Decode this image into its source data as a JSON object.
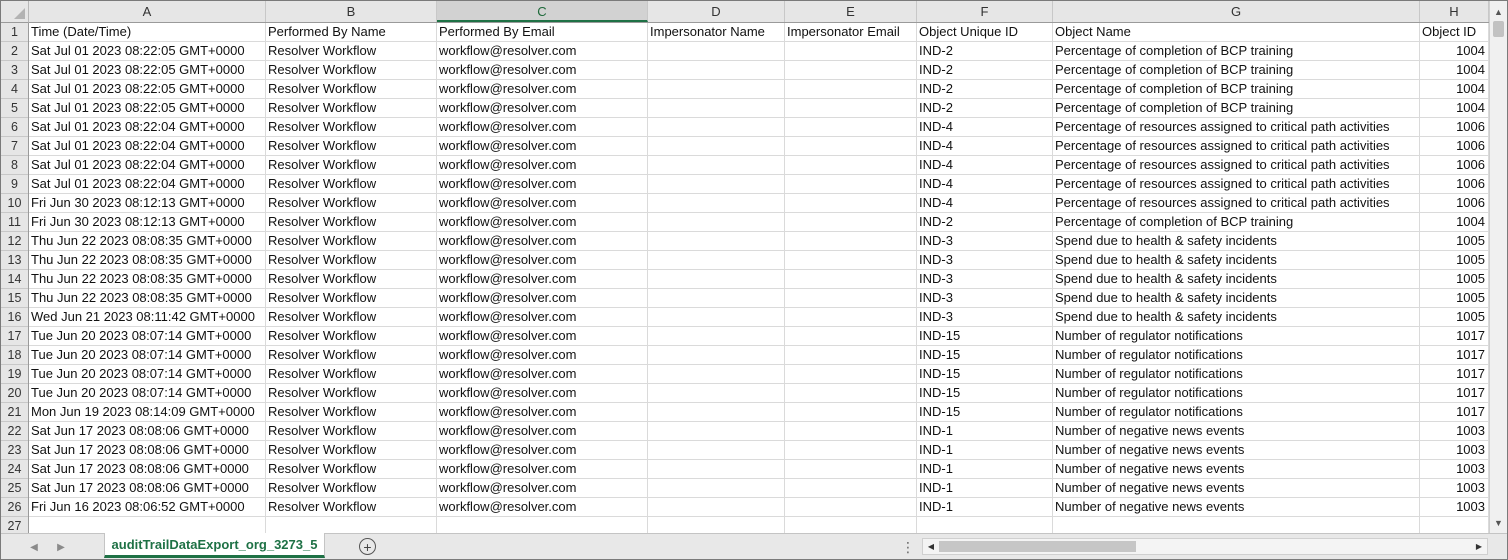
{
  "columns": [
    "A",
    "B",
    "C",
    "D",
    "E",
    "F",
    "G",
    "H"
  ],
  "active_column": "C",
  "row_numbers": [
    "1",
    "2",
    "3",
    "4",
    "5",
    "6",
    "7",
    "8",
    "9",
    "10",
    "11",
    "12",
    "13",
    "14",
    "15",
    "16",
    "17",
    "18",
    "19",
    "20",
    "21",
    "22",
    "23",
    "24",
    "25",
    "26",
    "27"
  ],
  "rows": [
    [
      "Time (Date/Time)",
      "Performed By Name",
      "Performed By Email",
      "Impersonator Name",
      "Impersonator Email",
      "Object Unique ID",
      "Object Name",
      "Object ID"
    ],
    [
      "Sat Jul 01 2023 08:22:05 GMT+0000",
      "Resolver Workflow",
      "workflow@resolver.com",
      "",
      "",
      "IND-2",
      "Percentage of completion of BCP training",
      "1004"
    ],
    [
      "Sat Jul 01 2023 08:22:05 GMT+0000",
      "Resolver Workflow",
      "workflow@resolver.com",
      "",
      "",
      "IND-2",
      "Percentage of completion of BCP training",
      "1004"
    ],
    [
      "Sat Jul 01 2023 08:22:05 GMT+0000",
      "Resolver Workflow",
      "workflow@resolver.com",
      "",
      "",
      "IND-2",
      "Percentage of completion of BCP training",
      "1004"
    ],
    [
      "Sat Jul 01 2023 08:22:05 GMT+0000",
      "Resolver Workflow",
      "workflow@resolver.com",
      "",
      "",
      "IND-2",
      "Percentage of completion of BCP training",
      "1004"
    ],
    [
      "Sat Jul 01 2023 08:22:04 GMT+0000",
      "Resolver Workflow",
      "workflow@resolver.com",
      "",
      "",
      "IND-4",
      "Percentage of resources assigned to critical path activities",
      "1006"
    ],
    [
      "Sat Jul 01 2023 08:22:04 GMT+0000",
      "Resolver Workflow",
      "workflow@resolver.com",
      "",
      "",
      "IND-4",
      "Percentage of resources assigned to critical path activities",
      "1006"
    ],
    [
      "Sat Jul 01 2023 08:22:04 GMT+0000",
      "Resolver Workflow",
      "workflow@resolver.com",
      "",
      "",
      "IND-4",
      "Percentage of resources assigned to critical path activities",
      "1006"
    ],
    [
      "Sat Jul 01 2023 08:22:04 GMT+0000",
      "Resolver Workflow",
      "workflow@resolver.com",
      "",
      "",
      "IND-4",
      "Percentage of resources assigned to critical path activities",
      "1006"
    ],
    [
      "Fri Jun 30 2023 08:12:13 GMT+0000",
      "Resolver Workflow",
      "workflow@resolver.com",
      "",
      "",
      "IND-4",
      "Percentage of resources assigned to critical path activities",
      "1006"
    ],
    [
      "Fri Jun 30 2023 08:12:13 GMT+0000",
      "Resolver Workflow",
      "workflow@resolver.com",
      "",
      "",
      "IND-2",
      "Percentage of completion of BCP training",
      "1004"
    ],
    [
      "Thu Jun 22 2023 08:08:35 GMT+0000",
      "Resolver Workflow",
      "workflow@resolver.com",
      "",
      "",
      "IND-3",
      "Spend due to health & safety incidents",
      "1005"
    ],
    [
      "Thu Jun 22 2023 08:08:35 GMT+0000",
      "Resolver Workflow",
      "workflow@resolver.com",
      "",
      "",
      "IND-3",
      "Spend due to health & safety incidents",
      "1005"
    ],
    [
      "Thu Jun 22 2023 08:08:35 GMT+0000",
      "Resolver Workflow",
      "workflow@resolver.com",
      "",
      "",
      "IND-3",
      "Spend due to health & safety incidents",
      "1005"
    ],
    [
      "Thu Jun 22 2023 08:08:35 GMT+0000",
      "Resolver Workflow",
      "workflow@resolver.com",
      "",
      "",
      "IND-3",
      "Spend due to health & safety incidents",
      "1005"
    ],
    [
      "Wed Jun 21 2023 08:11:42 GMT+0000",
      "Resolver Workflow",
      "workflow@resolver.com",
      "",
      "",
      "IND-3",
      "Spend due to health & safety incidents",
      "1005"
    ],
    [
      "Tue Jun 20 2023 08:07:14 GMT+0000",
      "Resolver Workflow",
      "workflow@resolver.com",
      "",
      "",
      "IND-15",
      "Number of regulator notifications",
      "1017"
    ],
    [
      "Tue Jun 20 2023 08:07:14 GMT+0000",
      "Resolver Workflow",
      "workflow@resolver.com",
      "",
      "",
      "IND-15",
      "Number of regulator notifications",
      "1017"
    ],
    [
      "Tue Jun 20 2023 08:07:14 GMT+0000",
      "Resolver Workflow",
      "workflow@resolver.com",
      "",
      "",
      "IND-15",
      "Number of regulator notifications",
      "1017"
    ],
    [
      "Tue Jun 20 2023 08:07:14 GMT+0000",
      "Resolver Workflow",
      "workflow@resolver.com",
      "",
      "",
      "IND-15",
      "Number of regulator notifications",
      "1017"
    ],
    [
      "Mon Jun 19 2023 08:14:09 GMT+0000",
      "Resolver Workflow",
      "workflow@resolver.com",
      "",
      "",
      "IND-15",
      "Number of regulator notifications",
      "1017"
    ],
    [
      "Sat Jun 17 2023 08:08:06 GMT+0000",
      "Resolver Workflow",
      "workflow@resolver.com",
      "",
      "",
      "IND-1",
      "Number of negative news events",
      "1003"
    ],
    [
      "Sat Jun 17 2023 08:08:06 GMT+0000",
      "Resolver Workflow",
      "workflow@resolver.com",
      "",
      "",
      "IND-1",
      "Number of negative news events",
      "1003"
    ],
    [
      "Sat Jun 17 2023 08:08:06 GMT+0000",
      "Resolver Workflow",
      "workflow@resolver.com",
      "",
      "",
      "IND-1",
      "Number of negative news events",
      "1003"
    ],
    [
      "Sat Jun 17 2023 08:08:06 GMT+0000",
      "Resolver Workflow",
      "workflow@resolver.com",
      "",
      "",
      "IND-1",
      "Number of negative news events",
      "1003"
    ],
    [
      "Fri Jun 16 2023 08:06:52 GMT+0000",
      "Resolver Workflow",
      "workflow@resolver.com",
      "",
      "",
      "IND-1",
      "Number of negative news events",
      "1003"
    ],
    [
      "",
      "",
      "",
      "",
      "",
      "",
      "",
      ""
    ]
  ],
  "sheet_tab": {
    "name": "auditTrailDataExport_org_3273_5"
  },
  "icons": {
    "corner": "select-all-triangle-icon",
    "prev": "chevron-left-icon",
    "next": "chevron-right-icon",
    "add": "plus-circle-icon",
    "more": "more-dots-icon",
    "scroll_up": "arrow-up-icon",
    "scroll_down": "arrow-down-icon",
    "scroll_left": "arrow-left-icon",
    "scroll_right": "arrow-right-icon"
  },
  "colors": {
    "accent": "#1e7145",
    "header_bg": "#e6e6e6",
    "grid_line": "#dadada"
  }
}
